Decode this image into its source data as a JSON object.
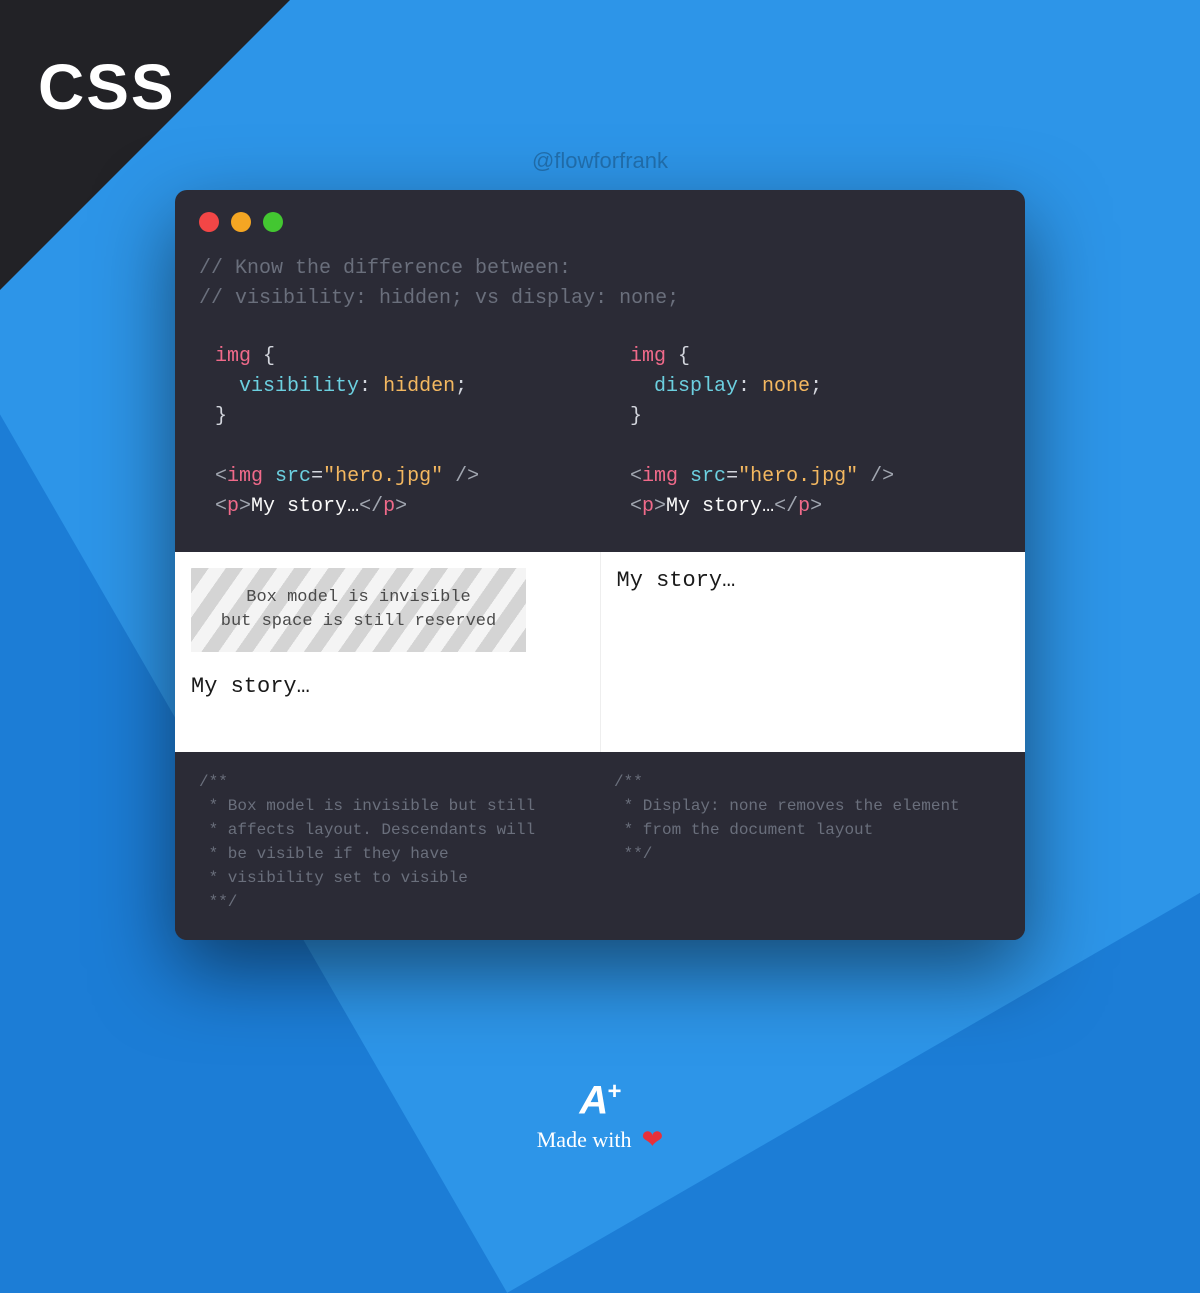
{
  "corner": {
    "label": "CSS"
  },
  "handle": "@flowforfrank",
  "comment": {
    "line1": "// Know the difference between:",
    "line2": "// visibility: hidden; vs display: none;"
  },
  "code": {
    "left": {
      "selector": "img",
      "property": "visibility",
      "value": "hidden",
      "html_tag_img": "img",
      "html_attr_src": "src",
      "html_src_val": "\"hero.jpg\"",
      "html_tag_p": "p",
      "html_text": "My story…"
    },
    "right": {
      "selector": "img",
      "property": "display",
      "value": "none",
      "html_tag_img": "img",
      "html_attr_src": "src",
      "html_src_val": "\"hero.jpg\"",
      "html_tag_p": "p",
      "html_text": "My story…"
    }
  },
  "preview": {
    "left_placeholder_line1": "Box model is invisible",
    "left_placeholder_line2": "but space is still reserved",
    "left_story": "My story…",
    "right_story": "My story…"
  },
  "explain": {
    "left": "/**\n * Box model is invisible but still\n * affects layout. Descendants will\n * be visible if they have\n * visibility set to visible\n **/",
    "right": "/**\n * Display: none removes the element\n * from the document layout\n **/"
  },
  "footer": {
    "logo_a": "A",
    "logo_plus": "+",
    "made": "Made with"
  }
}
